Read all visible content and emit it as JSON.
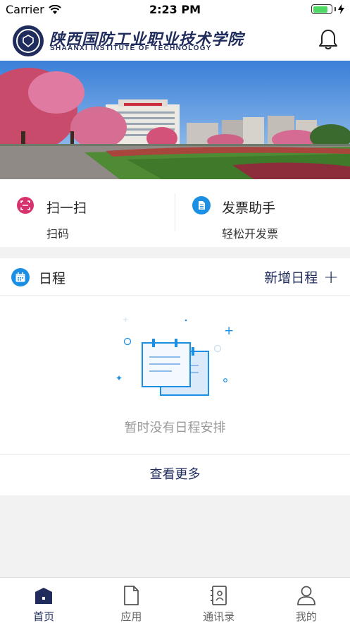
{
  "status_bar": {
    "carrier": "Carrier",
    "time": "2:23 PM",
    "battery_level": 0.8
  },
  "header": {
    "school_name_cn": "陕西国防工业职业技术学院",
    "school_name_en": "SHAANXI INSTITUTE OF TECHNOLOGY"
  },
  "quick_actions": [
    {
      "title": "扫一扫",
      "subtitle": "扫码",
      "icon": "scan-icon",
      "color": "#d8326e"
    },
    {
      "title": "发票助手",
      "subtitle": "轻松开发票",
      "icon": "document-icon",
      "color": "#1a8fe3"
    }
  ],
  "schedule": {
    "title": "日程",
    "add_label": "新增日程",
    "add_icon": "plus-icon",
    "empty_text": "暂时没有日程安排",
    "more_label": "查看更多"
  },
  "tabs": [
    {
      "label": "首页",
      "icon": "home-icon",
      "active": true
    },
    {
      "label": "应用",
      "icon": "apps-icon",
      "active": false
    },
    {
      "label": "通讯录",
      "icon": "contacts-icon",
      "active": false
    },
    {
      "label": "我的",
      "icon": "profile-icon",
      "active": false
    }
  ],
  "colors": {
    "brand": "#1f2c5c",
    "accent": "#1a8fe3",
    "scan": "#d8326e",
    "battery": "#4cd964"
  }
}
